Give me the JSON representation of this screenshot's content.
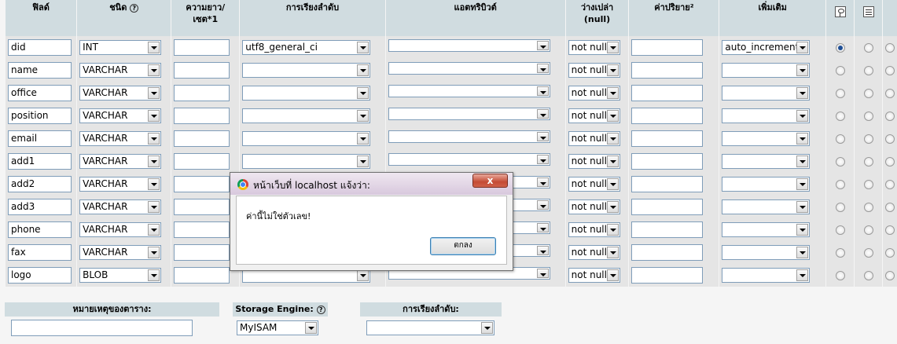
{
  "headers": {
    "field": "ฟิลด์",
    "type": "ชนิด",
    "length": "ความยาว/",
    "length_sub": "เซต*1",
    "collation": "การเรียงลำดับ",
    "attributes": "แอตทริบิวต์",
    "null": "ว่างเปล่า",
    "null_sub": "(null)",
    "default": "ค่าปริยาย²",
    "extra": "เพิ่มเติม"
  },
  "rows": [
    {
      "field": "did",
      "type": "INT",
      "collation": "utf8_general_ci",
      "null": "not null",
      "extra": "auto_increment",
      "primary": true
    },
    {
      "field": "name",
      "type": "VARCHAR",
      "collation": "",
      "null": "not null",
      "extra": "",
      "primary": false
    },
    {
      "field": "office",
      "type": "VARCHAR",
      "collation": "",
      "null": "not null",
      "extra": "",
      "primary": false
    },
    {
      "field": "position",
      "type": "VARCHAR",
      "collation": "",
      "null": "not null",
      "extra": "",
      "primary": false
    },
    {
      "field": "email",
      "type": "VARCHAR",
      "collation": "",
      "null": "not null",
      "extra": "",
      "primary": false
    },
    {
      "field": "add1",
      "type": "VARCHAR",
      "collation": "",
      "null": "not null",
      "extra": "",
      "primary": false
    },
    {
      "field": "add2",
      "type": "VARCHAR",
      "collation": "",
      "null": "not null",
      "extra": "",
      "primary": false
    },
    {
      "field": "add3",
      "type": "VARCHAR",
      "collation": "",
      "null": "not null",
      "extra": "",
      "primary": false
    },
    {
      "field": "phone",
      "type": "VARCHAR",
      "collation": "",
      "null": "not null",
      "extra": "",
      "primary": false
    },
    {
      "field": "fax",
      "type": "VARCHAR",
      "collation": "",
      "null": "not null",
      "extra": "",
      "primary": false
    },
    {
      "field": "logo",
      "type": "BLOB",
      "collation": "",
      "null": "not null",
      "extra": "",
      "primary": false
    }
  ],
  "bottom": {
    "comment_label": "หมายเหตุของตาราง:",
    "engine_label": "Storage Engine:",
    "engine_value": "MyISAM",
    "collation_label": "การเรียงลำดับ:"
  },
  "dialog": {
    "title": "หน้าเว็บที่ localhost แจ้งว่า:",
    "message": "ค่านี้ไม่ใช่ตัวเลข!",
    "ok_label": "ตกลง",
    "close_glyph": "x"
  }
}
